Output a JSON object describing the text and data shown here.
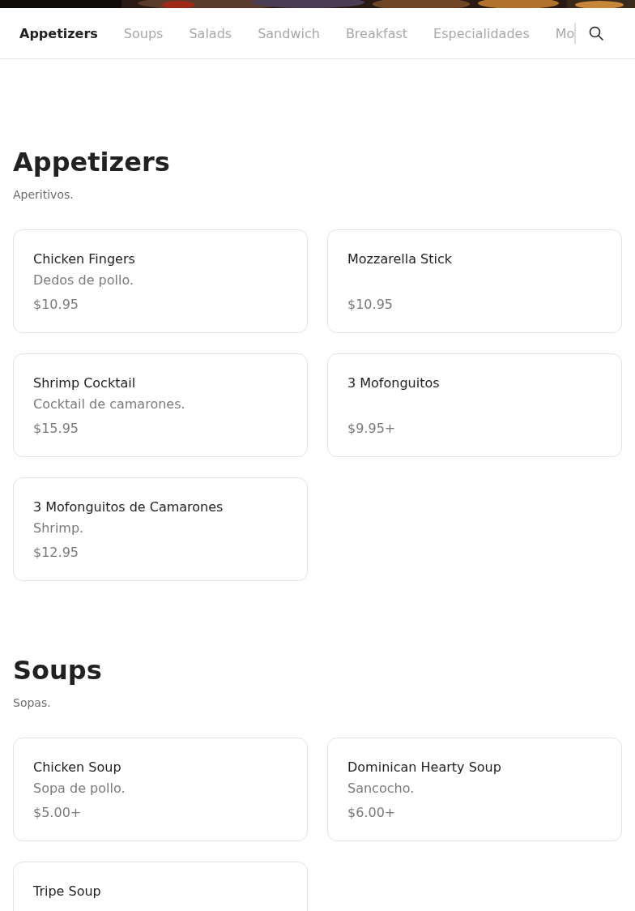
{
  "tabs": [
    {
      "label": "Appetizers",
      "selected": true
    },
    {
      "label": "Soups",
      "selected": false
    },
    {
      "label": "Salads",
      "selected": false
    },
    {
      "label": "Sandwich",
      "selected": false
    },
    {
      "label": "Breakfast",
      "selected": false
    },
    {
      "label": "Especialidades",
      "selected": false
    },
    {
      "label": "Mo",
      "selected": false
    }
  ],
  "sections": [
    {
      "title": "Appetizers",
      "subtitle": "Aperitivos.",
      "items": [
        {
          "name": "Chicken Fingers",
          "description": "Dedos de pollo.",
          "price": "$10.95"
        },
        {
          "name": "Mozzarella Stick",
          "price": "$10.95"
        },
        {
          "name": "Shrimp Cocktail",
          "description": "Cocktail de camarones.",
          "price": "$15.95"
        },
        {
          "name": "3 Mofonguitos",
          "price": "$9.95+"
        },
        {
          "name": "3 Mofonguitos de Camarones",
          "description": "Shrimp.",
          "price": "$12.95"
        }
      ]
    },
    {
      "title": "Soups",
      "subtitle": "Sopas.",
      "items": [
        {
          "name": "Chicken Soup",
          "description": "Sopa de pollo.",
          "price": "$5.00+"
        },
        {
          "name": "Dominican Hearty Soup",
          "description": "Sancocho.",
          "price": "$6.00+"
        },
        {
          "name": "Tripe Soup"
        }
      ]
    }
  ]
}
